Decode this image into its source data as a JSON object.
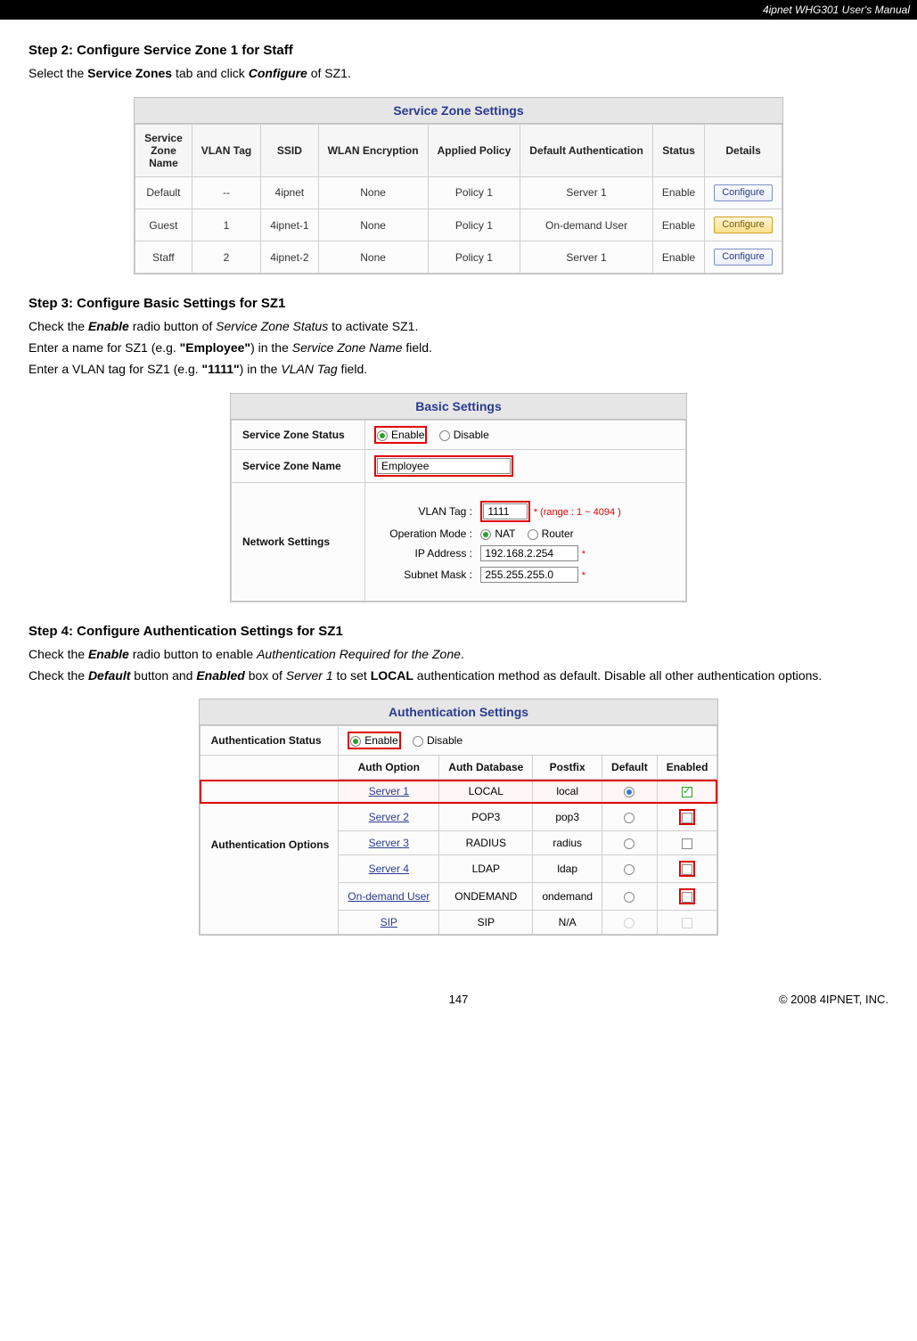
{
  "header_right": "4ipnet WHG301 User's Manual",
  "step2": {
    "title": "Step 2: Configure Service Zone 1 for Staff",
    "line_pre": "Select the ",
    "line_b1": "Service Zones",
    "line_mid": " tab and click ",
    "line_b2": "Configure",
    "line_post": " of SZ1."
  },
  "szt": {
    "caption": "Service Zone Settings",
    "headers": [
      "Service Zone Name",
      "VLAN Tag",
      "SSID",
      "WLAN Encryption",
      "Applied Policy",
      "Default Authentication",
      "Status",
      "Details"
    ],
    "rows": [
      {
        "name": "Default",
        "vlan": "--",
        "ssid": "4ipnet",
        "enc": "None",
        "pol": "Policy 1",
        "auth": "Server 1",
        "status": "Enable",
        "btn": "Configure"
      },
      {
        "name": "Guest",
        "vlan": "1",
        "ssid": "4ipnet-1",
        "enc": "None",
        "pol": "Policy 1",
        "auth": "On-demand User",
        "status": "Enable",
        "btn": "Configure"
      },
      {
        "name": "Staff",
        "vlan": "2",
        "ssid": "4ipnet-2",
        "enc": "None",
        "pol": "Policy 1",
        "auth": "Server 1",
        "status": "Enable",
        "btn": "Configure"
      }
    ]
  },
  "step3": {
    "title": "Step 3: Configure Basic Settings for SZ1",
    "l1_a": "Check the ",
    "l1_b": "Enable",
    "l1_c": " radio button of ",
    "l1_d": "Service Zone Status",
    "l1_e": " to activate SZ1.",
    "l2_a": "Enter a name for SZ1 (e.g. ",
    "l2_b": "\"Employee\"",
    "l2_c": ") in the ",
    "l2_d": "Service Zone Name",
    "l2_e": " field.",
    "l3_a": "Enter a VLAN tag for SZ1 (e.g. ",
    "l3_b": "\"1111\"",
    "l3_c": ") in the ",
    "l3_d": "VLAN Tag",
    "l3_e": " field."
  },
  "bs": {
    "caption": "Basic Settings",
    "status_label": "Service Zone Status",
    "enable": "Enable",
    "disable": "Disable",
    "name_label": "Service Zone Name",
    "name_value": "Employee",
    "net_label": "Network Settings",
    "vlan_label": "VLAN Tag :",
    "vlan_value": "1111",
    "vlan_hint": "* (range : 1 ~ 4094 )",
    "op_label": "Operation Mode :",
    "op_nat": "NAT",
    "op_router": "Router",
    "ip_label": "IP Address :",
    "ip_value": "192.168.2.254",
    "mask_label": "Subnet Mask :",
    "mask_value": "255.255.255.0",
    "star": "*"
  },
  "step4": {
    "title": "Step 4: Configure Authentication Settings for SZ1",
    "l1_a": "Check the ",
    "l1_b": "Enable",
    "l1_c": " radio button to enable ",
    "l1_d": "Authentication Required for the Zone",
    "l1_e": ".",
    "l2_a": "Check the ",
    "l2_b": "Default",
    "l2_c": " button and ",
    "l2_d": "Enabled",
    "l2_e": " box of ",
    "l2_f": "Server 1",
    "l2_g": " to set ",
    "l2_h": "LOCAL",
    "l2_i": " authentication method as default. Disable all other authentication options."
  },
  "as": {
    "caption": "Authentication Settings",
    "status_label": "Authentication Status",
    "enable": "Enable",
    "disable": "Disable",
    "opts_label": "Authentication Options",
    "iheaders": [
      "Auth Option",
      "Auth Database",
      "Postfix",
      "Default",
      "Enabled"
    ],
    "rows": [
      {
        "opt": "Server 1",
        "db": "LOCAL",
        "pf": "local",
        "def": "sel",
        "en": "green",
        "hl": true
      },
      {
        "opt": "Server 2",
        "db": "POP3",
        "pf": "pop3",
        "def": "",
        "en": "box",
        "hl": false
      },
      {
        "opt": "Server 3",
        "db": "RADIUS",
        "pf": "radius",
        "def": "",
        "en": "",
        "hl": false
      },
      {
        "opt": "Server 4",
        "db": "LDAP",
        "pf": "ldap",
        "def": "",
        "en": "box",
        "hl": false
      },
      {
        "opt": "On-demand User",
        "db": "ONDEMAND",
        "pf": "ondemand",
        "def": "",
        "en": "box",
        "hl": false
      },
      {
        "opt": "SIP",
        "db": "SIP",
        "pf": "N/A",
        "def": "dis",
        "en": "dis",
        "hl": false
      }
    ]
  },
  "footer": {
    "page": "147",
    "copyright": "© 2008 4IPNET, INC."
  }
}
